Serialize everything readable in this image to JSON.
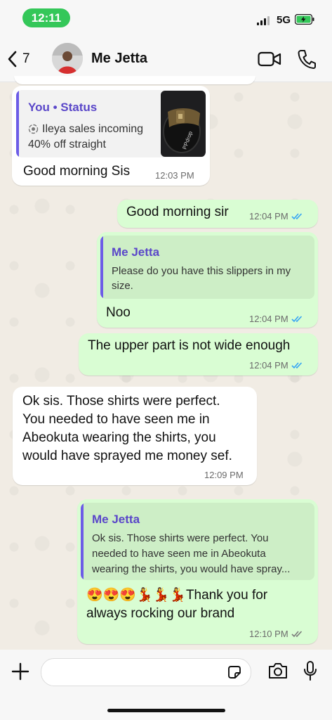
{
  "status_bar": {
    "time": "12:11",
    "network": "5G"
  },
  "header": {
    "back_count": "7",
    "contact_name": "Me Jetta"
  },
  "messages": [
    {
      "type": "incoming",
      "quote": {
        "title": "You • Status",
        "lines": [
          "Ileya sales incoming",
          "40% off straight"
        ],
        "thumbnail": "sandal-photo"
      },
      "text": "Good morning Sis",
      "time": "12:03 PM"
    },
    {
      "type": "outgoing",
      "text": "Good morning sir",
      "time": "12:04 PM",
      "ticks": "read"
    },
    {
      "type": "outgoing",
      "quote": {
        "title": "Me Jetta",
        "text": "Please do you have this slippers in my size."
      },
      "text": "Noo",
      "time": "12:04 PM",
      "ticks": "read"
    },
    {
      "type": "outgoing",
      "text": "The upper part is not wide enough",
      "time": "12:04 PM",
      "ticks": "read"
    },
    {
      "type": "incoming",
      "lines": [
        "Ok sis. Those shirts were perfect.",
        "You needed to have seen me in",
        "Abeokuta wearing the shirts, you",
        "would have sprayed me money sef."
      ],
      "time": "12:09 PM"
    },
    {
      "type": "outgoing",
      "quote": {
        "title": "Me Jetta",
        "lines": [
          "Ok sis. Those shirts were perfect. You",
          "needed to have seen me in Abeokuta",
          "wearing the shirts, you would have spray..."
        ]
      },
      "lines": [
        "😍😍😍💃💃💃Thank you for",
        "always rocking our brand"
      ],
      "time": "12:10 PM",
      "ticks": "delivered"
    }
  ],
  "colors": {
    "outgoing_bubble": "#d9fdd3",
    "incoming_bubble": "#ffffff",
    "read_tick": "#34a3f5",
    "quote_bar": "#6c5ce7",
    "status_pill": "#34c759"
  },
  "icons": [
    "chevron-left-icon",
    "video-call-icon",
    "phone-icon",
    "plus-icon",
    "sticker-icon",
    "camera-icon",
    "microphone-icon"
  ]
}
